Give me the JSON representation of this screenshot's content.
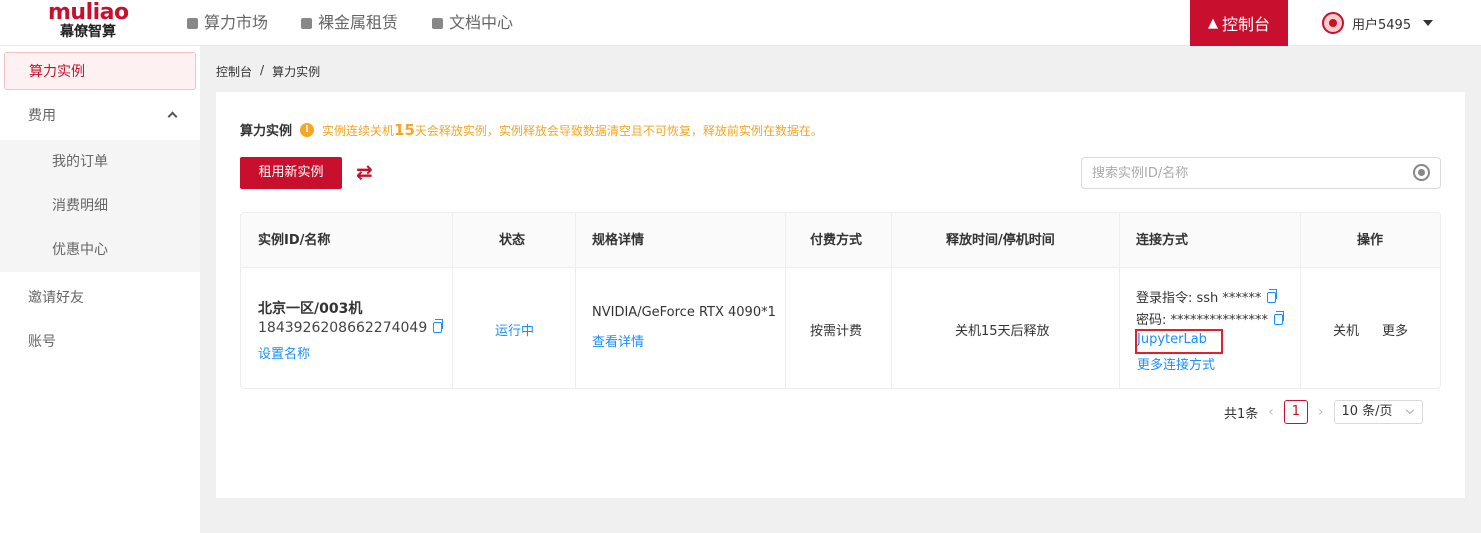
{
  "brand": {
    "name": "muliao",
    "subtitle": "幕僚智算"
  },
  "topnav": {
    "items": [
      {
        "label": "算力市场",
        "icon": "cloud-icon"
      },
      {
        "label": "裸金属租赁",
        "icon": "server-icon"
      },
      {
        "label": "文档中心",
        "icon": "document-icon"
      }
    ],
    "console_label": "控制台",
    "user_label": "用户5495"
  },
  "sidebar": {
    "items": [
      {
        "label": "算力实例",
        "active": true
      },
      {
        "label": "费用",
        "expanded": true
      },
      {
        "label": "我的订单",
        "sub": true
      },
      {
        "label": "消费明细",
        "sub": true
      },
      {
        "label": "优惠中心",
        "sub": true
      },
      {
        "label": "邀请好友"
      },
      {
        "label": "账号"
      }
    ]
  },
  "breadcrumb": {
    "root": "控制台",
    "sep": "/",
    "current": "算力实例"
  },
  "main": {
    "title": "算力实例",
    "warning_pre": "实例连续关机",
    "warning_days": "15",
    "warning_post": "天会释放实例，实例释放会导致数据清空且不可恢复，释放前实例在数据在。",
    "rent_button": "租用新实例",
    "search_placeholder": "搜索实例ID/名称"
  },
  "table": {
    "headers": [
      "实例ID/名称",
      "状态",
      "规格详情",
      "付费方式",
      "释放时间/停机时间",
      "连接方式",
      "操作"
    ],
    "row": {
      "name": "北京一区/003机",
      "id": "1843926208662274049",
      "set_name": "设置名称",
      "status": "运行中",
      "spec": "NVIDIA/GeForce RTX 4090*1",
      "spec_detail": "查看详情",
      "pay": "按需计费",
      "release": "关机15天后释放",
      "login_cmd": "登录指令: ssh ******",
      "password": "密码: ***************",
      "jupyter": "JupyterLab",
      "more_connect": "更多连接方式",
      "op_shutdown": "关机",
      "op_more": "更多"
    }
  },
  "pagination": {
    "total": "共1条",
    "current_page": "1",
    "page_size": "10 条/页"
  },
  "colors": {
    "brand": "#c8102e",
    "link": "#1890ff",
    "warning": "#f5a623"
  }
}
